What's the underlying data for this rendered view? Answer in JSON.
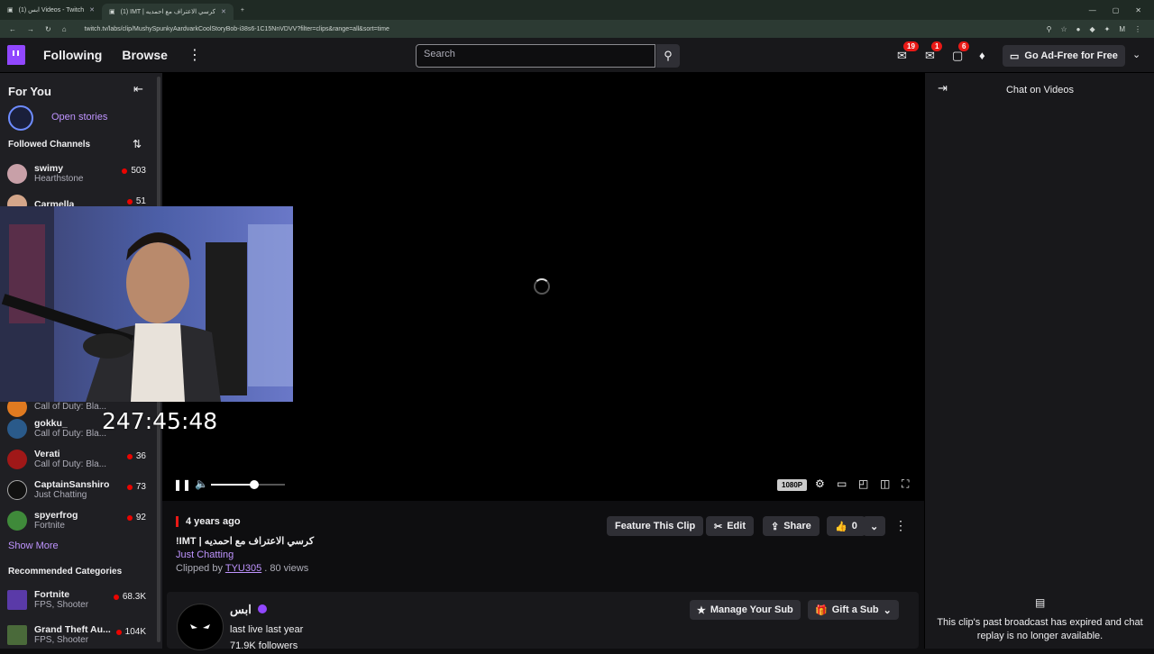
{
  "browser": {
    "tabs": [
      {
        "title": "ابس (1) Videos - Twitch"
      },
      {
        "title": "(1) IMT | كرسي الاعتراف مع احمديه"
      }
    ],
    "url": "twitch.tv/labs/clip/MushySpunkyAardvarkCoolStoryBob-i38s6-1C15NnVDVV?filter=clips&range=all&sort=time"
  },
  "topnav": {
    "following": "Following",
    "browse": "Browse",
    "search_placeholder": "Search",
    "badges": {
      "inbox": "19",
      "whispers": "1",
      "activity": "6"
    },
    "adfree": "Go Ad-Free for Free"
  },
  "sidebar": {
    "for_you": "For You",
    "open_stories": "Open stories",
    "followed": "Followed Channels",
    "channels": [
      {
        "name": "swimy",
        "game": "Hearthstone",
        "viewers": "503"
      },
      {
        "name": "Carmella",
        "game": "",
        "viewers": "51"
      },
      {
        "name": "",
        "game": "Call of Duty: Bla...",
        "viewers": ""
      },
      {
        "name": "gokku_",
        "game": "Call of Duty: Bla...",
        "viewers": ""
      },
      {
        "name": "Verati",
        "game": "Call of Duty: Bla...",
        "viewers": "36"
      },
      {
        "name": "CaptainSanshiro",
        "game": "Just Chatting",
        "viewers": "73"
      },
      {
        "name": "spyerfrog",
        "game": "Fortnite",
        "viewers": "92"
      }
    ],
    "show_more": "Show More",
    "recommended": "Recommended Categories",
    "categories": [
      {
        "name": "Fortnite",
        "tags": "FPS, Shooter",
        "viewers": "68.3K"
      },
      {
        "name": "Grand Theft Au...",
        "tags": "FPS, Shooter",
        "viewers": "104K"
      }
    ]
  },
  "player": {
    "timer": "247:45:48",
    "quality": "1080P"
  },
  "clip": {
    "ago": "4 years ago",
    "title": "!IMT | كرسي الاعتراف مع احمديه",
    "category": "Just Chatting",
    "clipped_by_label": "Clipped by",
    "clipped_by": "TYU305",
    "views": "80 views",
    "feature": "Feature This Clip",
    "edit": "Edit",
    "share": "Share",
    "likes": "0"
  },
  "channel": {
    "name": "ابس",
    "last_live": "last live last year",
    "followers": "71.9K followers",
    "manage_sub": "Manage Your Sub",
    "gift_sub": "Gift a Sub"
  },
  "chat": {
    "title": "Chat on Videos",
    "message": "This clip's past broadcast has expired and chat replay is no longer available."
  },
  "colors": {
    "brand": "#9147ff",
    "live": "#eb0400",
    "link": "#bf94ff"
  }
}
